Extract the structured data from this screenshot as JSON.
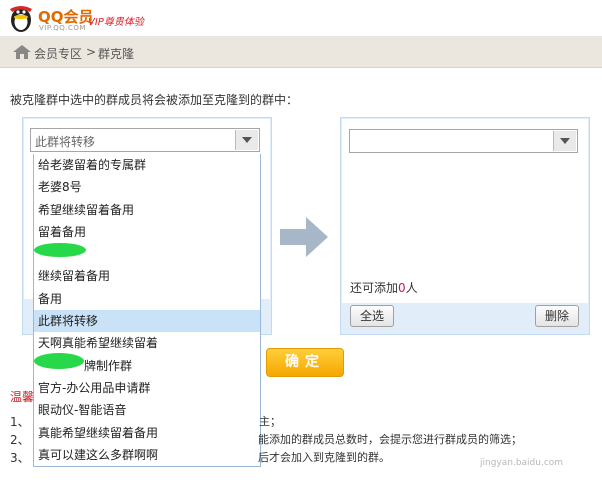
{
  "header": {
    "logo_text": "QQ会员",
    "logo_sub": "VIP.QQ.COM",
    "logo_slogan": "VIP尊贵体验"
  },
  "breadcrumb": {
    "home": "会员专区",
    "separator": ">",
    "current": "群克隆"
  },
  "intro": "被克隆群中选中的群成员将会被添加至克隆到的群中：",
  "left_select": {
    "value": "此群将转移",
    "options": [
      "给老婆留着的专属群",
      "老婆8号",
      "希望继续留着备用",
      "留着备用",
      "",
      "继续留着备用",
      "备用",
      "此群将转移",
      "天啊真能希望继续留着",
      "牌制作群",
      "官方-办公用品申请群",
      "眼动仪-智能语音",
      "真能希望继续留着备用",
      "真可以建这么多群啊啊"
    ],
    "selected_index": 7
  },
  "right_panel": {
    "select_value": "",
    "count_prefix": "还可添加",
    "count_value": "0",
    "count_suffix": "人",
    "select_all_label": "全选",
    "delete_label": "删除"
  },
  "confirm_label": "确定",
  "tips": {
    "title": "温馨",
    "items": [
      {
        "num": "1、",
        "text": "主；"
      },
      {
        "num": "2、",
        "text": "能添加的群成员总数时，会提示您进行群成员的筛选；"
      },
      {
        "num": "3、",
        "text": "后才会加入到克隆到的群。"
      }
    ]
  },
  "watermark": "jingyan.baidu.com",
  "colors": {
    "accent_confirm": "#f6a700",
    "panel_bg": "#e1eefa",
    "count_highlight": "#d0115f",
    "tips_title": "#c7232b"
  }
}
